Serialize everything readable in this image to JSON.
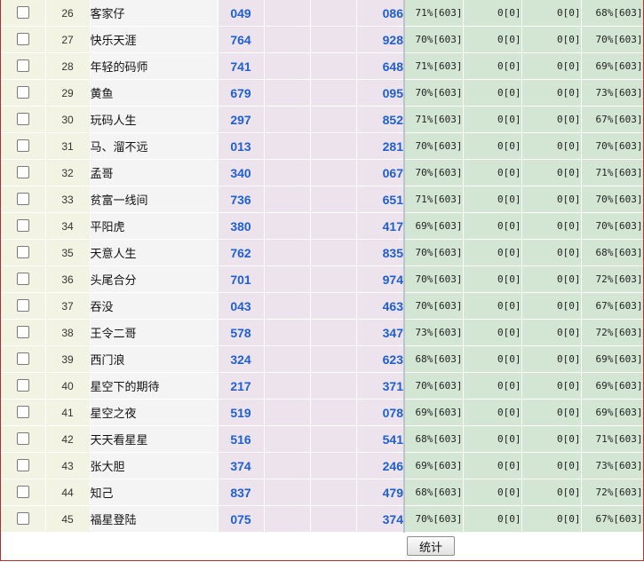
{
  "rows": [
    {
      "idx": "26",
      "name": "客家仔",
      "n1": "049",
      "n2": "086",
      "s1": "71%[603]",
      "s2": "0[0]",
      "s3": "0[0]",
      "s4": "68%[603]"
    },
    {
      "idx": "27",
      "name": "快乐天涯",
      "n1": "764",
      "n2": "928",
      "s1": "70%[603]",
      "s2": "0[0]",
      "s3": "0[0]",
      "s4": "70%[603]"
    },
    {
      "idx": "28",
      "name": "年轻的码师",
      "n1": "741",
      "n2": "648",
      "s1": "71%[603]",
      "s2": "0[0]",
      "s3": "0[0]",
      "s4": "69%[603]"
    },
    {
      "idx": "29",
      "name": "黄鱼",
      "n1": "679",
      "n2": "095",
      "s1": "70%[603]",
      "s2": "0[0]",
      "s3": "0[0]",
      "s4": "73%[603]"
    },
    {
      "idx": "30",
      "name": "玩码人生",
      "n1": "297",
      "n2": "852",
      "s1": "71%[603]",
      "s2": "0[0]",
      "s3": "0[0]",
      "s4": "67%[603]"
    },
    {
      "idx": "31",
      "name": "马、溜不远",
      "n1": "013",
      "n2": "281",
      "s1": "70%[603]",
      "s2": "0[0]",
      "s3": "0[0]",
      "s4": "70%[603]"
    },
    {
      "idx": "32",
      "name": "孟哥",
      "n1": "340",
      "n2": "067",
      "s1": "70%[603]",
      "s2": "0[0]",
      "s3": "0[0]",
      "s4": "71%[603]"
    },
    {
      "idx": "33",
      "name": "贫富一线间",
      "n1": "736",
      "n2": "651",
      "s1": "71%[603]",
      "s2": "0[0]",
      "s3": "0[0]",
      "s4": "70%[603]"
    },
    {
      "idx": "34",
      "name": "平阳虎",
      "n1": "380",
      "n2": "417",
      "s1": "69%[603]",
      "s2": "0[0]",
      "s3": "0[0]",
      "s4": "70%[603]"
    },
    {
      "idx": "35",
      "name": "天意人生",
      "n1": "762",
      "n2": "835",
      "s1": "70%[603]",
      "s2": "0[0]",
      "s3": "0[0]",
      "s4": "68%[603]"
    },
    {
      "idx": "36",
      "name": "头尾合分",
      "n1": "701",
      "n2": "974",
      "s1": "70%[603]",
      "s2": "0[0]",
      "s3": "0[0]",
      "s4": "72%[603]"
    },
    {
      "idx": "37",
      "name": "吞没",
      "n1": "043",
      "n2": "463",
      "s1": "70%[603]",
      "s2": "0[0]",
      "s3": "0[0]",
      "s4": "67%[603]"
    },
    {
      "idx": "38",
      "name": "王令二哥",
      "n1": "578",
      "n2": "347",
      "s1": "73%[603]",
      "s2": "0[0]",
      "s3": "0[0]",
      "s4": "72%[603]"
    },
    {
      "idx": "39",
      "name": "西门浪",
      "n1": "324",
      "n2": "623",
      "s1": "68%[603]",
      "s2": "0[0]",
      "s3": "0[0]",
      "s4": "69%[603]"
    },
    {
      "idx": "40",
      "name": "星空下的期待",
      "n1": "217",
      "n2": "371",
      "s1": "70%[603]",
      "s2": "0[0]",
      "s3": "0[0]",
      "s4": "69%[603]"
    },
    {
      "idx": "41",
      "name": "星空之夜",
      "n1": "519",
      "n2": "078",
      "s1": "69%[603]",
      "s2": "0[0]",
      "s3": "0[0]",
      "s4": "69%[603]"
    },
    {
      "idx": "42",
      "name": "天天看星星",
      "n1": "516",
      "n2": "541",
      "s1": "68%[603]",
      "s2": "0[0]",
      "s3": "0[0]",
      "s4": "71%[603]"
    },
    {
      "idx": "43",
      "name": "张大胆",
      "n1": "374",
      "n2": "246",
      "s1": "69%[603]",
      "s2": "0[0]",
      "s3": "0[0]",
      "s4": "73%[603]"
    },
    {
      "idx": "44",
      "name": "知己",
      "n1": "837",
      "n2": "479",
      "s1": "68%[603]",
      "s2": "0[0]",
      "s3": "0[0]",
      "s4": "72%[603]"
    },
    {
      "idx": "45",
      "name": "福星登陆",
      "n1": "075",
      "n2": "374",
      "s1": "70%[603]",
      "s2": "0[0]",
      "s3": "0[0]",
      "s4": "67%[603]"
    }
  ],
  "footer": {
    "stats_button_label": "统计"
  },
  "colors": {
    "number_blue": "#1f5fd0",
    "index_bg": "#f3f3e3",
    "name_bg": "#f4f4f4",
    "number_bg": "#ece3ec",
    "stat_bg": "#d3e6d3",
    "frame_border": "#b03030"
  }
}
